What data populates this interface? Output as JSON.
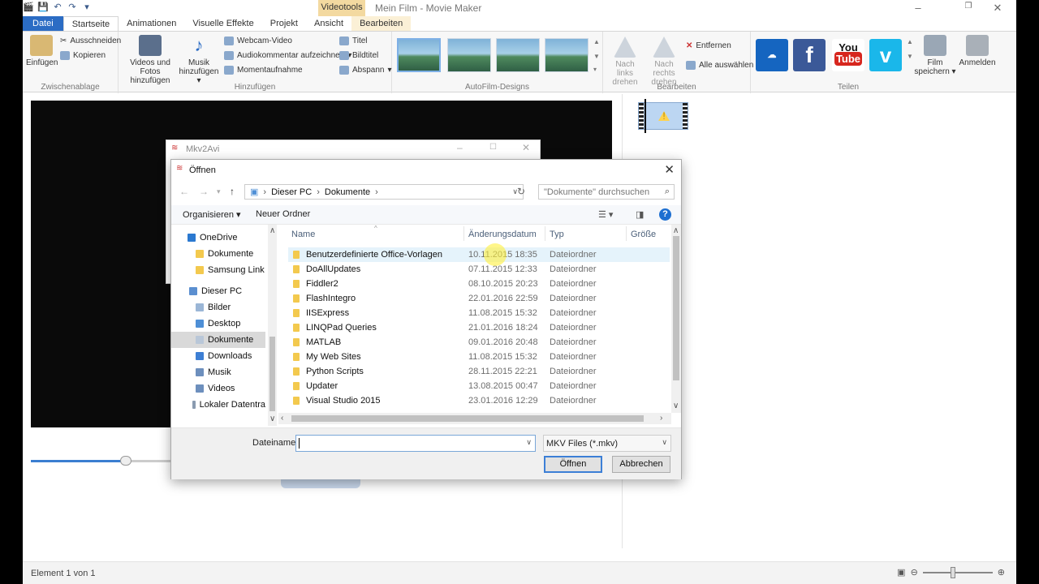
{
  "app": {
    "title": "Mein Film - Movie Maker",
    "context_tab_group": "Videotools",
    "minimize": "–",
    "maximize": "❐",
    "close": "✕"
  },
  "ribbon": {
    "tabs": [
      "Datei",
      "Startseite",
      "Animationen",
      "Visuelle Effekte",
      "Projekt",
      "Ansicht",
      "Bearbeiten"
    ],
    "clipboard": {
      "paste": "Einfügen",
      "cut": "Ausschneiden",
      "copy": "Kopieren",
      "label": "Zwischenablage"
    },
    "add": {
      "videos_photos": [
        "Videos und Fotos",
        "hinzufügen"
      ],
      "music": [
        "Musik",
        "hinzufügen"
      ],
      "webcam": "Webcam-Video",
      "narration": "Audiokommentar aufzeichnen",
      "snapshot": "Momentaufnahme",
      "title": "Titel",
      "caption": "Bildtitel",
      "credits": "Abspann",
      "label": "Hinzufügen"
    },
    "themes_label": "AutoFilm-Designs",
    "edit": {
      "rotate_left": [
        "Nach links",
        "drehen"
      ],
      "rotate_right": [
        "Nach rechts",
        "drehen"
      ],
      "remove": "Entfernen",
      "select_all": "Alle auswählen",
      "label": "Bearbeiten"
    },
    "share": {
      "youtube_top": "You",
      "youtube_bottom": "Tube",
      "save_movie": [
        "Film",
        "speichern"
      ],
      "signin": "Anmelden",
      "label": "Teilen"
    }
  },
  "mkv_window": {
    "title": "Mkv2Avi"
  },
  "dialog": {
    "title": "Öffnen",
    "breadcrumb": [
      "Dieser PC",
      "Dokumente"
    ],
    "search_placeholder": "\"Dokumente\" durchsuchen",
    "organize": "Organisieren",
    "new_folder": "Neuer Ordner",
    "nav": [
      {
        "label": "OneDrive",
        "color": "#2b79d0",
        "sel": false
      },
      {
        "label": "Dokumente",
        "color": "#f3c94e",
        "sel": false
      },
      {
        "label": "Samsung Link",
        "color": "#f3c94e",
        "sel": false
      },
      {
        "label": "Dieser PC",
        "color": "#5b8fd0",
        "sel": false
      },
      {
        "label": "Bilder",
        "color": "#9bb6d6",
        "sel": false
      },
      {
        "label": "Desktop",
        "color": "#4e8fd6",
        "sel": false
      },
      {
        "label": "Dokumente",
        "color": "#b9c7d8",
        "sel": true
      },
      {
        "label": "Downloads",
        "color": "#3d7fd4",
        "sel": false
      },
      {
        "label": "Musik",
        "color": "#6d8fbd",
        "sel": false
      },
      {
        "label": "Videos",
        "color": "#6d8fbd",
        "sel": false
      },
      {
        "label": "Lokaler Datentra",
        "color": "#8a9bb0",
        "sel": false
      }
    ],
    "columns": {
      "name": "Name",
      "date": "Änderungsdatum",
      "type": "Typ",
      "size": "Größe"
    },
    "files": [
      {
        "name": "Benutzerdefinierte Office-Vorlagen",
        "date": "10.11.2015 18:35",
        "type": "Dateiordner"
      },
      {
        "name": "DoAllUpdates",
        "date": "07.11.2015 12:33",
        "type": "Dateiordner"
      },
      {
        "name": "Fiddler2",
        "date": "08.10.2015 20:23",
        "type": "Dateiordner"
      },
      {
        "name": "FlashIntegro",
        "date": "22.01.2016 22:59",
        "type": "Dateiordner"
      },
      {
        "name": "IISExpress",
        "date": "11.08.2015 15:32",
        "type": "Dateiordner"
      },
      {
        "name": "LINQPad Queries",
        "date": "21.01.2016 18:24",
        "type": "Dateiordner"
      },
      {
        "name": "MATLAB",
        "date": "09.01.2016 20:48",
        "type": "Dateiordner"
      },
      {
        "name": "My Web Sites",
        "date": "11.08.2015 15:32",
        "type": "Dateiordner"
      },
      {
        "name": "Python Scripts",
        "date": "28.11.2015 22:21",
        "type": "Dateiordner"
      },
      {
        "name": "Updater",
        "date": "13.08.2015 00:47",
        "type": "Dateiordner"
      },
      {
        "name": "Visual Studio 2015",
        "date": "23.01.2016 12:29",
        "type": "Dateiordner"
      }
    ],
    "filename_label": "Dateiname:",
    "filename_value": "",
    "filetype": "MKV Files (*.mkv)",
    "open": "Öffnen",
    "cancel": "Abbrechen"
  },
  "status": {
    "text": "Element 1 von 1"
  }
}
